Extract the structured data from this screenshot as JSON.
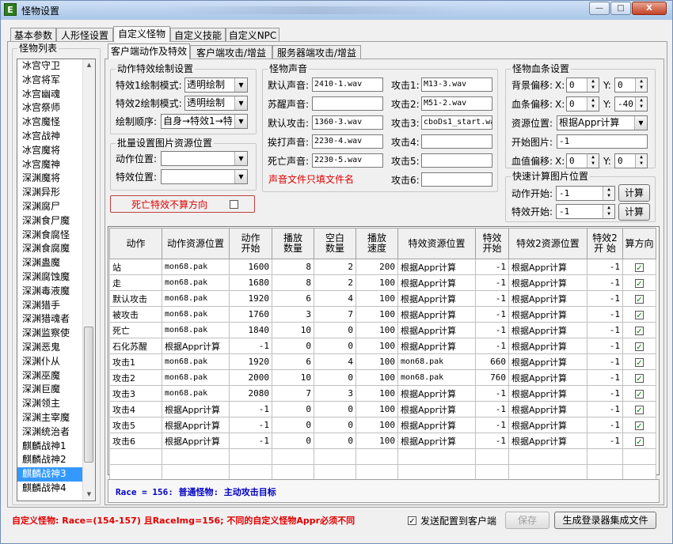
{
  "window": {
    "title": "怪物设置",
    "app_icon_letter": "E",
    "minimize_label": "—",
    "maximize_label": "□",
    "close_label": "X"
  },
  "main_tabs": [
    "基本参数",
    "人形怪设置",
    "自定义怪物",
    "自定义技能",
    "自定义NPC"
  ],
  "monster_list": {
    "title": "怪物列表",
    "items": [
      "冰宫守卫",
      "冰宫将军",
      "冰宫幽魂",
      "冰宫祭师",
      "冰宫魔怪",
      "冰宫战神",
      "冰宫魔将",
      "冰宫魔神",
      "深渊魔将",
      "深渊异形",
      "深渊腐尸",
      "深渊食尸魔",
      "深渊食腐怪",
      "深渊食腐魔",
      "深渊蛊魔",
      "深渊腐蚀魔",
      "深渊毒液魔",
      "深渊猎手",
      "深渊猎魂者",
      "深渊监察使",
      "深渊恶鬼",
      "深渊仆从",
      "深渊巫魔",
      "深渊巨魔",
      "深渊领主",
      "深渊主宰魔",
      "深渊统治者",
      "麒麟战神1",
      "麒麟战神2",
      "麒麟战神3",
      "麒麟战神4"
    ],
    "selected": "麒麟战神3"
  },
  "sub_tabs": [
    "客户端动作及特效",
    "客户端攻击/增益",
    "服务器端攻击/增益"
  ],
  "action_effect": {
    "title": "动作特效绘制设置",
    "effect1_label": "特效1绘制模式:",
    "effect1_value": "透明绘制",
    "effect2_label": "特效2绘制模式:",
    "effect2_value": "透明绘制",
    "order_label": "绘制顺序:",
    "order_value": "自身→特效1→特"
  },
  "batch": {
    "title": "批量设置图片资源位置",
    "action_label": "动作位置:",
    "action_value": "",
    "effect_label": "特效位置:",
    "effect_value": ""
  },
  "death_effect": {
    "label": "死亡特效不算方向",
    "checked": false
  },
  "sound": {
    "title": "怪物声音",
    "default_label": "默认声音:",
    "default_value": "2410-1.wav",
    "revive_label": "苏醒声音:",
    "revive_value": "",
    "default_attack_label": "默认攻击:",
    "default_attack_value": "1360-3.wav",
    "hit_label": "挨打声音:",
    "hit_value": "2230-4.wav",
    "death_label": "死亡声音:",
    "death_value": "2230-5.wav",
    "hint": "声音文件只填文件名",
    "atk1_label": "攻击1:",
    "atk1_value": "M13-3.wav",
    "atk2_label": "攻击2:",
    "atk2_value": "M51-2.wav",
    "atk3_label": "攻击3:",
    "atk3_value": "cboDs1_start.wa",
    "atk4_label": "攻击4:",
    "atk4_value": "",
    "atk5_label": "攻击5:",
    "atk5_value": "",
    "atk6_label": "攻击6:",
    "atk6_value": ""
  },
  "hpbar": {
    "title": "怪物血条设置",
    "bg_offset_label": "背景偏移:",
    "bg_x": "0",
    "bg_y": "0",
    "bar_offset_label": "血条偏移:",
    "bar_x": "0",
    "bar_y": "-40",
    "x_label": "X:",
    "y_label": "Y:",
    "res_label": "资源位置:",
    "res_value": "根据Appr计算",
    "start_label": "开始图片:",
    "start_value": "-1",
    "value_offset_label": "血值偏移:",
    "val_x": "0",
    "val_y": "0"
  },
  "quickcalc": {
    "title": "快速计算图片位置",
    "action_label": "动作开始:",
    "action_value": "-1",
    "effect_label": "特效开始:",
    "effect_value": "-1",
    "calc_label": "计算"
  },
  "table": {
    "headers": [
      "动作",
      "动作资源位置",
      "动作\n开始",
      "播放\n数量",
      "空白\n数量",
      "播放\n速度",
      "特效资源位置",
      "特效\n开始",
      "特效2资源位置",
      "特效2\n开 始",
      "算方向"
    ],
    "rows": [
      [
        "站",
        "mon68.pak",
        "1600",
        "8",
        "2",
        "200",
        "根据Appr计算",
        "-1",
        "根据Appr计算",
        "-1"
      ],
      [
        "走",
        "mon68.pak",
        "1680",
        "8",
        "2",
        "100",
        "根据Appr计算",
        "-1",
        "根据Appr计算",
        "-1"
      ],
      [
        "默认攻击",
        "mon68.pak",
        "1920",
        "6",
        "4",
        "100",
        "根据Appr计算",
        "-1",
        "根据Appr计算",
        "-1"
      ],
      [
        "被攻击",
        "mon68.pak",
        "1760",
        "3",
        "7",
        "100",
        "根据Appr计算",
        "-1",
        "根据Appr计算",
        "-1"
      ],
      [
        "死亡",
        "mon68.pak",
        "1840",
        "10",
        "0",
        "100",
        "根据Appr计算",
        "-1",
        "根据Appr计算",
        "-1"
      ],
      [
        "石化苏醒",
        "根据Appr计算",
        "-1",
        "0",
        "0",
        "100",
        "根据Appr计算",
        "-1",
        "根据Appr计算",
        "-1"
      ],
      [
        "攻击1",
        "mon68.pak",
        "1920",
        "6",
        "4",
        "100",
        "mon68.pak",
        "660",
        "根据Appr计算",
        "-1"
      ],
      [
        "攻击2",
        "mon68.pak",
        "2000",
        "10",
        "0",
        "100",
        "mon68.pak",
        "760",
        "根据Appr计算",
        "-1"
      ],
      [
        "攻击3",
        "mon68.pak",
        "2080",
        "7",
        "3",
        "100",
        "根据Appr计算",
        "-1",
        "根据Appr计算",
        "-1"
      ],
      [
        "攻击4",
        "根据Appr计算",
        "-1",
        "0",
        "0",
        "100",
        "根据Appr计算",
        "-1",
        "根据Appr计算",
        "-1"
      ],
      [
        "攻击5",
        "根据Appr计算",
        "-1",
        "0",
        "0",
        "100",
        "根据Appr计算",
        "-1",
        "根据Appr计算",
        "-1"
      ],
      [
        "攻击6",
        "根据Appr计算",
        "-1",
        "0",
        "0",
        "100",
        "根据Appr计算",
        "-1",
        "根据Appr计算",
        "-1"
      ]
    ],
    "direction_checked": true
  },
  "status_line": "Race = 156: 普通怪物: 主动攻击目标",
  "footer": {
    "warning": "自定义怪物: Race=(154-157) 且RaceImg=156; 不同的自定义怪物Appr必须不同",
    "send_label": "发送配置到客户端",
    "send_checked": true,
    "save_label": "保存",
    "generate_label": "生成登录器集成文件"
  },
  "colors": {
    "accent_red": "#e00000",
    "status_blue": "#0000c0",
    "selection": "#3399ff",
    "check_green": "#0a7a0a"
  }
}
